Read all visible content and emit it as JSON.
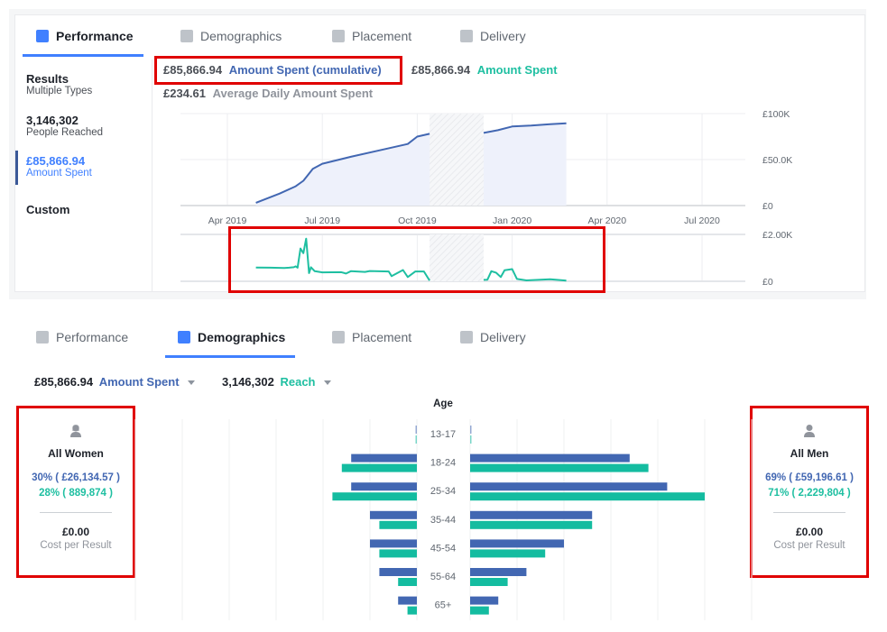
{
  "top_panel": {
    "tabs": [
      {
        "label": "Performance",
        "icon": "bar-chart-icon",
        "active": true
      },
      {
        "label": "Demographics",
        "icon": "people-icon",
        "active": false
      },
      {
        "label": "Placement",
        "icon": "placement-icon",
        "active": false
      },
      {
        "label": "Delivery",
        "icon": "line-chart-icon",
        "active": false
      }
    ],
    "sidebar": {
      "metrics": [
        {
          "value": "Results",
          "label": "Multiple Types"
        },
        {
          "value": "3,146,302",
          "label": "People Reached"
        },
        {
          "value": "£85,866.94",
          "label": "Amount Spent",
          "selected": true
        }
      ],
      "custom_label": "Custom"
    },
    "header": {
      "cumulative_value": "£85,866.94",
      "cumulative_label": "Amount Spent (cumulative)",
      "daily_value": "£85,866.94",
      "daily_label": "Amount Spent",
      "average_value": "£234.61",
      "average_label": "Average Daily Amount Spent"
    }
  },
  "bottom_panel": {
    "tabs": [
      {
        "label": "Performance",
        "icon": "bar-chart-icon",
        "active": false
      },
      {
        "label": "Demographics",
        "icon": "people-icon",
        "active": true
      },
      {
        "label": "Placement",
        "icon": "placement-icon",
        "active": false
      },
      {
        "label": "Delivery",
        "icon": "line-chart-icon",
        "active": false
      }
    ],
    "metric_selectors": [
      {
        "value": "£85,866.94",
        "label": "Amount Spent"
      },
      {
        "value": "3,146,302",
        "label": "Reach"
      }
    ],
    "women": {
      "title": "All Women",
      "spend_text": "30% ( £26,134.57 )",
      "reach_text": "28% ( 889,874 )",
      "cost_value": "£0.00",
      "cost_label": "Cost per Result"
    },
    "men": {
      "title": "All Men",
      "spend_text": "69% ( £59,196.61 )",
      "reach_text": "71% ( 2,229,804 )",
      "cost_value": "£0.00",
      "cost_label": "Cost per Result"
    }
  },
  "colors": {
    "spend": "#4267b2",
    "reach": "#1ebfa1",
    "accent": "#4080ff",
    "annotation": "#e00000"
  },
  "chart_data": [
    {
      "type": "area",
      "title": "Amount Spent (cumulative)",
      "x_ticks": [
        "Apr 2019",
        "Jul 2019",
        "Oct 2019",
        "Jan 2020",
        "Apr 2020",
        "Jul 2020"
      ],
      "y_ticks": [
        "£100K",
        "£50.0K",
        "£0"
      ],
      "ylim": [
        0,
        100000
      ],
      "gap_period": [
        "late Oct 2019",
        "early Dec 2019"
      ],
      "series": [
        {
          "name": "Amount Spent (cumulative)",
          "segments": [
            [
              [
                0.3,
                3000
              ],
              [
                0.55,
                13000
              ],
              [
                0.72,
                21000
              ],
              [
                0.8,
                27000
              ],
              [
                0.9,
                40000
              ],
              [
                1.0,
                45500
              ],
              [
                1.3,
                53000
              ],
              [
                1.6,
                60000
              ],
              [
                1.9,
                67000
              ],
              [
                2.0,
                75000
              ],
              [
                2.13,
                78000
              ]
            ],
            [
              [
                2.7,
                79000
              ],
              [
                2.85,
                82000
              ],
              [
                3.0,
                86000
              ],
              [
                3.2,
                87000
              ],
              [
                3.4,
                88500
              ],
              [
                3.57,
                89500
              ]
            ]
          ]
        }
      ],
      "x_units": "quarters after Apr 2019"
    },
    {
      "type": "line",
      "title": "Amount Spent (daily)",
      "y_ticks": [
        "£2.00K",
        "£0"
      ],
      "ylim": [
        0,
        2000
      ],
      "series": [
        {
          "name": "Amount Spent",
          "segments": [
            [
              [
                0.3,
                590
              ],
              [
                0.45,
                580
              ],
              [
                0.6,
                570
              ],
              [
                0.65,
                580
              ],
              [
                0.7,
                600
              ],
              [
                0.72,
                640
              ],
              [
                0.74,
                580
              ],
              [
                0.77,
                1400
              ],
              [
                0.8,
                1200
              ],
              [
                0.83,
                1820
              ],
              [
                0.86,
                350
              ],
              [
                0.88,
                600
              ],
              [
                0.92,
                430
              ],
              [
                1.0,
                380
              ],
              [
                1.2,
                390
              ],
              [
                1.25,
                330
              ],
              [
                1.3,
                430
              ],
              [
                1.45,
                400
              ],
              [
                1.5,
                440
              ],
              [
                1.7,
                420
              ],
              [
                1.73,
                220
              ],
              [
                1.85,
                480
              ],
              [
                1.9,
                180
              ],
              [
                1.98,
                420
              ],
              [
                2.07,
                420
              ],
              [
                2.13,
                30
              ]
            ],
            [
              [
                2.7,
                60
              ],
              [
                2.74,
                70
              ],
              [
                2.78,
                430
              ],
              [
                2.83,
                370
              ],
              [
                2.88,
                180
              ],
              [
                2.92,
                470
              ],
              [
                3.0,
                520
              ],
              [
                3.05,
                100
              ],
              [
                3.15,
                40
              ],
              [
                3.3,
                70
              ],
              [
                3.4,
                90
              ],
              [
                3.57,
                30
              ]
            ]
          ]
        }
      ],
      "x_units": "quarters after Apr 2019"
    },
    {
      "type": "bar",
      "title": "Age",
      "categories": [
        "13-17",
        "18-24",
        "25-34",
        "35-44",
        "45-54",
        "55-64",
        "65+"
      ],
      "series": [
        {
          "name": "Women – Amount Spent",
          "values": [
            0.02,
            1.4,
            1.4,
            1.0,
            1.0,
            0.8,
            0.4
          ]
        },
        {
          "name": "Women – Reach",
          "values": [
            0.02,
            1.6,
            1.8,
            0.8,
            0.8,
            0.4,
            0.2
          ]
        },
        {
          "name": "Men – Amount Spent",
          "values": [
            0.02,
            3.4,
            4.2,
            2.6,
            2.0,
            1.2,
            0.6
          ]
        },
        {
          "name": "Men – Reach",
          "values": [
            0.02,
            3.8,
            5.0,
            2.6,
            1.6,
            0.8,
            0.4
          ]
        }
      ],
      "value_units": "relative gridline units",
      "xlim": [
        0,
        6
      ]
    }
  ]
}
